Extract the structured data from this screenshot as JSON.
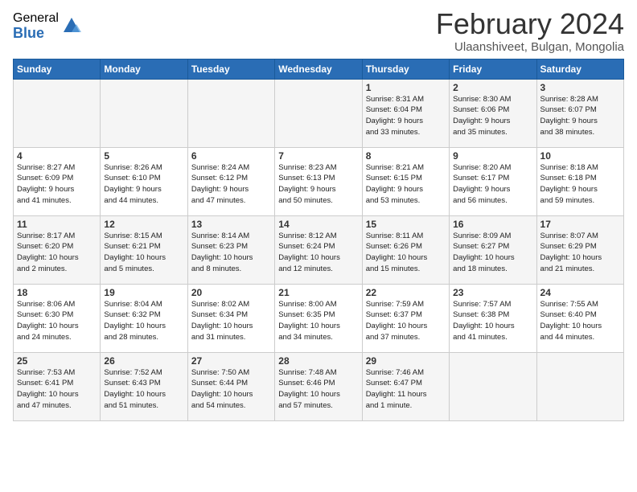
{
  "logo": {
    "general": "General",
    "blue": "Blue"
  },
  "title": "February 2024",
  "subtitle": "Ulaanshiveet, Bulgan, Mongolia",
  "weekdays": [
    "Sunday",
    "Monday",
    "Tuesday",
    "Wednesday",
    "Thursday",
    "Friday",
    "Saturday"
  ],
  "weeks": [
    [
      {
        "day": "",
        "info": ""
      },
      {
        "day": "",
        "info": ""
      },
      {
        "day": "",
        "info": ""
      },
      {
        "day": "",
        "info": ""
      },
      {
        "day": "1",
        "info": "Sunrise: 8:31 AM\nSunset: 6:04 PM\nDaylight: 9 hours\nand 33 minutes."
      },
      {
        "day": "2",
        "info": "Sunrise: 8:30 AM\nSunset: 6:06 PM\nDaylight: 9 hours\nand 35 minutes."
      },
      {
        "day": "3",
        "info": "Sunrise: 8:28 AM\nSunset: 6:07 PM\nDaylight: 9 hours\nand 38 minutes."
      }
    ],
    [
      {
        "day": "4",
        "info": "Sunrise: 8:27 AM\nSunset: 6:09 PM\nDaylight: 9 hours\nand 41 minutes."
      },
      {
        "day": "5",
        "info": "Sunrise: 8:26 AM\nSunset: 6:10 PM\nDaylight: 9 hours\nand 44 minutes."
      },
      {
        "day": "6",
        "info": "Sunrise: 8:24 AM\nSunset: 6:12 PM\nDaylight: 9 hours\nand 47 minutes."
      },
      {
        "day": "7",
        "info": "Sunrise: 8:23 AM\nSunset: 6:13 PM\nDaylight: 9 hours\nand 50 minutes."
      },
      {
        "day": "8",
        "info": "Sunrise: 8:21 AM\nSunset: 6:15 PM\nDaylight: 9 hours\nand 53 minutes."
      },
      {
        "day": "9",
        "info": "Sunrise: 8:20 AM\nSunset: 6:17 PM\nDaylight: 9 hours\nand 56 minutes."
      },
      {
        "day": "10",
        "info": "Sunrise: 8:18 AM\nSunset: 6:18 PM\nDaylight: 9 hours\nand 59 minutes."
      }
    ],
    [
      {
        "day": "11",
        "info": "Sunrise: 8:17 AM\nSunset: 6:20 PM\nDaylight: 10 hours\nand 2 minutes."
      },
      {
        "day": "12",
        "info": "Sunrise: 8:15 AM\nSunset: 6:21 PM\nDaylight: 10 hours\nand 5 minutes."
      },
      {
        "day": "13",
        "info": "Sunrise: 8:14 AM\nSunset: 6:23 PM\nDaylight: 10 hours\nand 8 minutes."
      },
      {
        "day": "14",
        "info": "Sunrise: 8:12 AM\nSunset: 6:24 PM\nDaylight: 10 hours\nand 12 minutes."
      },
      {
        "day": "15",
        "info": "Sunrise: 8:11 AM\nSunset: 6:26 PM\nDaylight: 10 hours\nand 15 minutes."
      },
      {
        "day": "16",
        "info": "Sunrise: 8:09 AM\nSunset: 6:27 PM\nDaylight: 10 hours\nand 18 minutes."
      },
      {
        "day": "17",
        "info": "Sunrise: 8:07 AM\nSunset: 6:29 PM\nDaylight: 10 hours\nand 21 minutes."
      }
    ],
    [
      {
        "day": "18",
        "info": "Sunrise: 8:06 AM\nSunset: 6:30 PM\nDaylight: 10 hours\nand 24 minutes."
      },
      {
        "day": "19",
        "info": "Sunrise: 8:04 AM\nSunset: 6:32 PM\nDaylight: 10 hours\nand 28 minutes."
      },
      {
        "day": "20",
        "info": "Sunrise: 8:02 AM\nSunset: 6:34 PM\nDaylight: 10 hours\nand 31 minutes."
      },
      {
        "day": "21",
        "info": "Sunrise: 8:00 AM\nSunset: 6:35 PM\nDaylight: 10 hours\nand 34 minutes."
      },
      {
        "day": "22",
        "info": "Sunrise: 7:59 AM\nSunset: 6:37 PM\nDaylight: 10 hours\nand 37 minutes."
      },
      {
        "day": "23",
        "info": "Sunrise: 7:57 AM\nSunset: 6:38 PM\nDaylight: 10 hours\nand 41 minutes."
      },
      {
        "day": "24",
        "info": "Sunrise: 7:55 AM\nSunset: 6:40 PM\nDaylight: 10 hours\nand 44 minutes."
      }
    ],
    [
      {
        "day": "25",
        "info": "Sunrise: 7:53 AM\nSunset: 6:41 PM\nDaylight: 10 hours\nand 47 minutes."
      },
      {
        "day": "26",
        "info": "Sunrise: 7:52 AM\nSunset: 6:43 PM\nDaylight: 10 hours\nand 51 minutes."
      },
      {
        "day": "27",
        "info": "Sunrise: 7:50 AM\nSunset: 6:44 PM\nDaylight: 10 hours\nand 54 minutes."
      },
      {
        "day": "28",
        "info": "Sunrise: 7:48 AM\nSunset: 6:46 PM\nDaylight: 10 hours\nand 57 minutes."
      },
      {
        "day": "29",
        "info": "Sunrise: 7:46 AM\nSunset: 6:47 PM\nDaylight: 11 hours\nand 1 minute."
      },
      {
        "day": "",
        "info": ""
      },
      {
        "day": "",
        "info": ""
      }
    ]
  ]
}
